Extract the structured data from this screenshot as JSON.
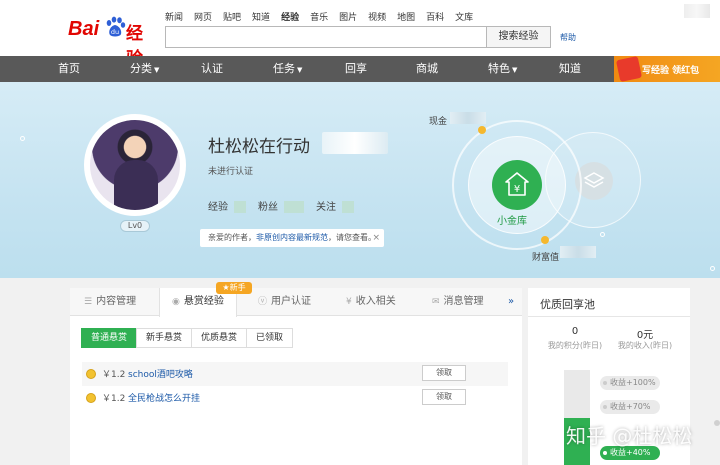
{
  "header": {
    "logo_bai": "Bai",
    "logo_du": "du",
    "logo_jingyan": "经验",
    "nav_links": [
      "新闻",
      "网页",
      "贴吧",
      "知道",
      "经验",
      "音乐",
      "图片",
      "视频",
      "地图",
      "百科",
      "文库"
    ],
    "active_link": "经验",
    "search_value": "",
    "search_button": "搜索经验",
    "help": "帮助"
  },
  "navbar": {
    "items": [
      "首页",
      "分类",
      "认证",
      "任务",
      "回享",
      "商城",
      "特色",
      "知道"
    ],
    "dropdown_items": [
      "分类",
      "任务",
      "特色"
    ],
    "promo": "写经验 领红包",
    "promo_arrow": "›"
  },
  "profile": {
    "username": "杜松松在行动",
    "verify_status": "未进行认证",
    "level": "Lv0",
    "stat_labels": [
      "经验",
      "粉丝",
      "关注"
    ],
    "notice_prefix": "亲爱的作者，",
    "notice_link": "非原创内容最新规范",
    "notice_suffix": "，请您查看。",
    "notice_close": "×",
    "cash_label": "现金",
    "wealth_label": "财富值",
    "vault_label": "小金库"
  },
  "panel": {
    "tabs": [
      "内容管理",
      "悬赏经验",
      "用户认证",
      "收入相关",
      "消息管理"
    ],
    "active_tab": "悬赏经验",
    "new_badge": "新手",
    "more": "»",
    "subtabs": [
      "普通悬赏",
      "新手悬赏",
      "优质悬赏",
      "已领取"
    ],
    "active_subtab": "普通悬赏",
    "rows": [
      {
        "amount": "￥1.2",
        "title": "school酒吧攻略",
        "action": "领取"
      },
      {
        "amount": "￥1.2",
        "title": "全民枪战怎么开挂",
        "action": "领取"
      }
    ]
  },
  "side": {
    "title": "优质回享池",
    "stats": [
      {
        "value": "0",
        "label": "我的积分(昨日)"
      },
      {
        "value": "0元",
        "label": "我的收入(昨日)"
      }
    ],
    "levels": [
      "收益+100%",
      "收益+70%",
      "收益+40%"
    ],
    "active_level_index": 2,
    "fill_fraction": 0.5
  },
  "watermark": "知乎 @杜松松",
  "colors": {
    "brand_red": "#e10602",
    "green": "#2fb052",
    "navbar": "#595959",
    "link_blue": "#1d5aa8",
    "promo_orange": "#f08a12"
  }
}
